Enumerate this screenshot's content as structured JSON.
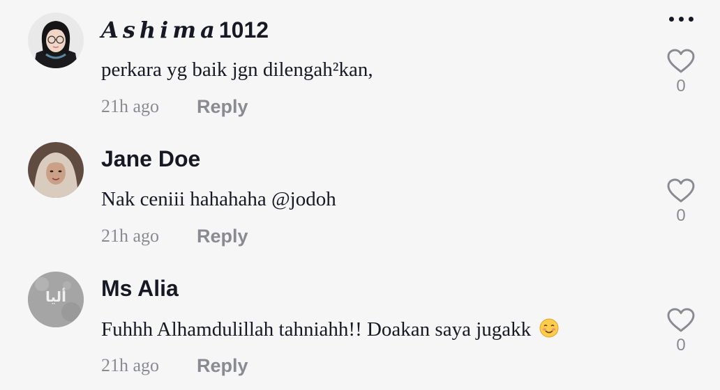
{
  "header": {
    "more_icon": "more-horizontal-icon"
  },
  "comments": [
    {
      "username_stylized": "Ashima",
      "username_suffix": "1012",
      "text": "perkara yg baik jgn dilengah²kan,",
      "time": "21h ago",
      "reply_label": "Reply",
      "like_count": "0",
      "like_icon": "heart-icon"
    },
    {
      "username": "Jane Doe",
      "text": "Nak ceniii hahahaha @jodoh",
      "time": "21h ago",
      "reply_label": "Reply",
      "like_count": "0",
      "like_icon": "heart-icon"
    },
    {
      "username": "Ms Alia",
      "avatar_text": "أليا",
      "text": "Fuhhh Alhamdulillah tahniahh!! Doakan saya jugakk",
      "emoji_icon": "smiling-face-icon",
      "time": "21h ago",
      "reply_label": "Reply",
      "like_count": "0",
      "like_icon": "heart-icon"
    }
  ],
  "colors": {
    "background": "#f6f6f6",
    "primary_text": "#161823",
    "secondary_text": "#8a8b91"
  }
}
